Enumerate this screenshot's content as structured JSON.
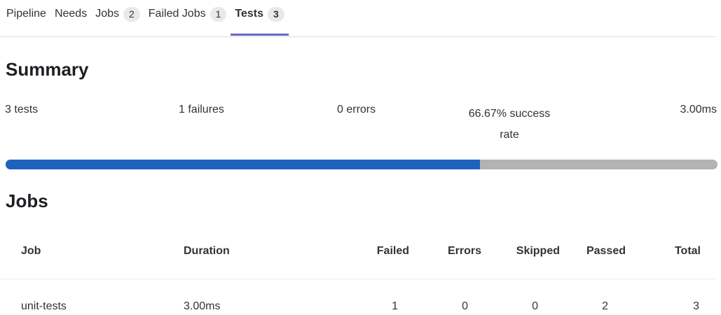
{
  "tabs": [
    {
      "label": "Pipeline"
    },
    {
      "label": "Needs"
    },
    {
      "label": "Jobs",
      "count": "2"
    },
    {
      "label": "Failed Jobs",
      "count": "1"
    },
    {
      "label": "Tests",
      "count": "3"
    }
  ],
  "summary": {
    "heading": "Summary",
    "tests": "3 tests",
    "failures": "1 failures",
    "errors": "0 errors",
    "success_line1": "66.67% success",
    "success_line2": "rate",
    "duration": "3.00ms",
    "success_rate": 0.6667
  },
  "jobs": {
    "heading": "Jobs",
    "columns": {
      "job": "Job",
      "duration": "Duration",
      "failed": "Failed",
      "errors": "Errors",
      "skipped": "Skipped",
      "passed": "Passed",
      "total": "Total"
    },
    "rows": [
      {
        "job": "unit-tests",
        "duration": "3.00ms",
        "failed": "1",
        "errors": "0",
        "skipped": "0",
        "passed": "2",
        "total": "3"
      }
    ]
  },
  "colors": {
    "accent": "#6666c4",
    "progress_fill": "#1f62bd",
    "progress_track": "#b3b3b3"
  }
}
